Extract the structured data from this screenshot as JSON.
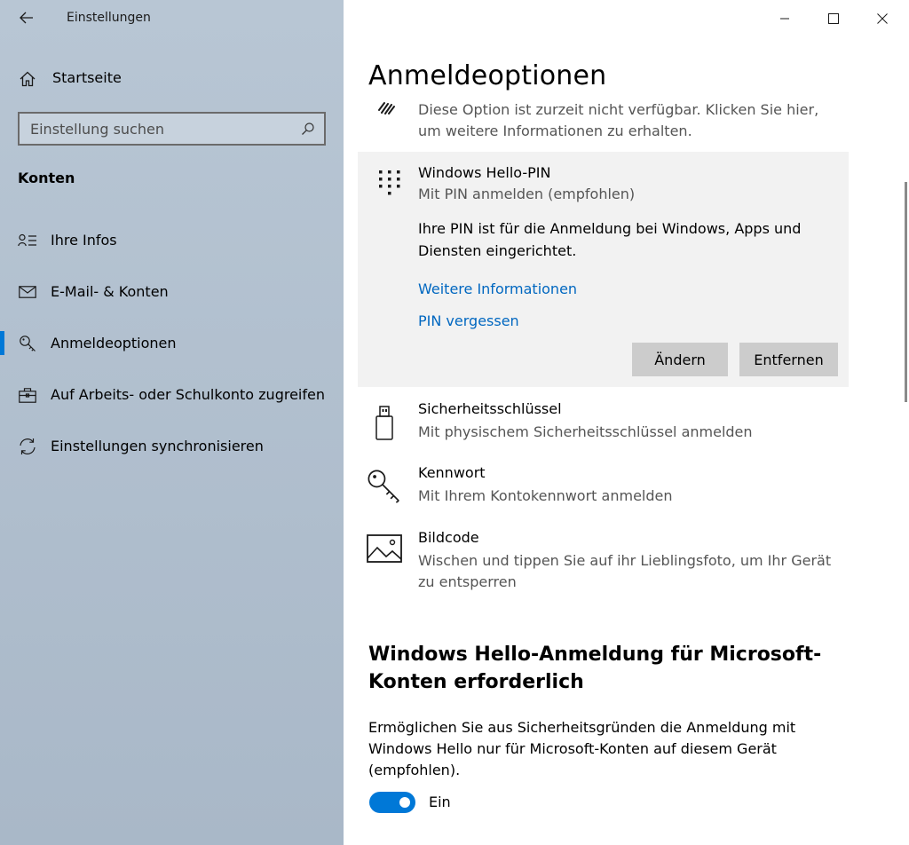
{
  "window": {
    "app_title": "Einstellungen",
    "controls": [
      "minimize",
      "maximize",
      "close"
    ]
  },
  "sidebar": {
    "home_label": "Startseite",
    "search_placeholder": "Einstellung suchen",
    "section_title": "Konten",
    "items": [
      {
        "label": "Ihre Infos",
        "icon": "person-list-icon",
        "active": false
      },
      {
        "label": "E-Mail- & Konten",
        "icon": "mail-icon",
        "active": false
      },
      {
        "label": "Anmeldeoptionen",
        "icon": "key-icon",
        "active": true
      },
      {
        "label": "Auf Arbeits- oder Schulkonto zugreifen",
        "icon": "briefcase-icon",
        "active": false
      },
      {
        "label": "Einstellungen synchronisieren",
        "icon": "sync-icon",
        "active": false
      }
    ]
  },
  "main": {
    "page_title": "Anmeldeoptionen",
    "fingerprint_note": "Diese Option ist zurzeit nicht verfügbar. Klicken Sie hier, um weitere Informationen zu erhalten.",
    "pin": {
      "title": "Windows Hello-PIN",
      "subtitle": "Mit PIN anmelden (empfohlen)",
      "description": "Ihre PIN ist für die Anmeldung bei Windows, Apps und Diensten eingerichtet.",
      "link_more": "Weitere Informationen",
      "link_forgot": "PIN vergessen",
      "btn_change": "Ändern",
      "btn_remove": "Entfernen"
    },
    "options": [
      {
        "title": "Sicherheitsschlüssel",
        "subtitle": "Mit physischem Sicherheitsschlüssel anmelden",
        "icon": "usb-key-icon"
      },
      {
        "title": "Kennwort",
        "subtitle": "Mit Ihrem Kontokennwort anmelden",
        "icon": "password-key-icon"
      },
      {
        "title": "Bildcode",
        "subtitle": "Wischen und tippen Sie auf ihr Lieblingsfoto, um Ihr Gerät zu entsperren",
        "icon": "picture-icon"
      }
    ],
    "hello_section": {
      "heading": "Windows Hello-Anmeldung für Microsoft-Konten erforderlich",
      "description": "Ermöglichen Sie aus Sicherheitsgründen die Anmeldung mit Windows Hello nur für Microsoft-Konten auf diesem Gerät (empfohlen).",
      "toggle_state": "Ein",
      "toggle_on": true
    }
  },
  "colors": {
    "accent": "#0078d7",
    "link": "#0067c0",
    "sidebar_bg": "#b2c1d0",
    "panel_bg": "#f2f2f2",
    "button_bg": "#cccccc"
  }
}
